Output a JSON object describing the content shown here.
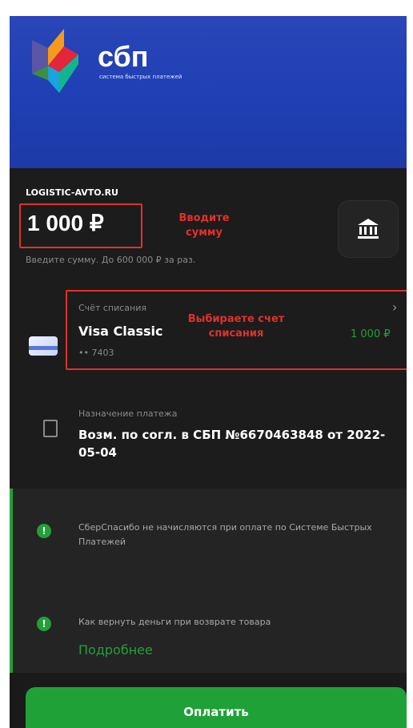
{
  "header": {
    "logo_text": "сбп",
    "logo_subtitle": "система быстрых платежей"
  },
  "payment": {
    "merchant": "LOGISTIC-AVTO.RU",
    "amount": "1 000 ₽",
    "amount_hint": "Введите сумму. До 600 000 ₽ за раз."
  },
  "annotations": {
    "amount": "Вводите сумму",
    "account": "Выбираете счет списания"
  },
  "account": {
    "label": "Счёт списания",
    "name": "Visa Classic",
    "number": "•• 7403",
    "balance": "1 000 ₽"
  },
  "purpose": {
    "label": "Назначение платежа",
    "text": "Возм. по согл. в СБП №6670463848 от 2022-05-04"
  },
  "info": [
    {
      "text": "СберСпасибо не начисляются при оплате по Системе Быстрых Платежей"
    },
    {
      "text": "Как вернуть деньги при возврате товара"
    }
  ],
  "more_link": "Подробнее",
  "pay_button": "Оплатить",
  "icons": {
    "logo": "sbp-logo-icon",
    "bank": "bank-icon",
    "card": "card-icon",
    "document": "document-icon",
    "info": "info-icon",
    "chevron": "chevron-right-icon"
  },
  "colors": {
    "accent_green": "#21a038",
    "header_blue": "#2a46b8",
    "annotation_red": "#e2302a",
    "background": "#1c1c1c"
  }
}
